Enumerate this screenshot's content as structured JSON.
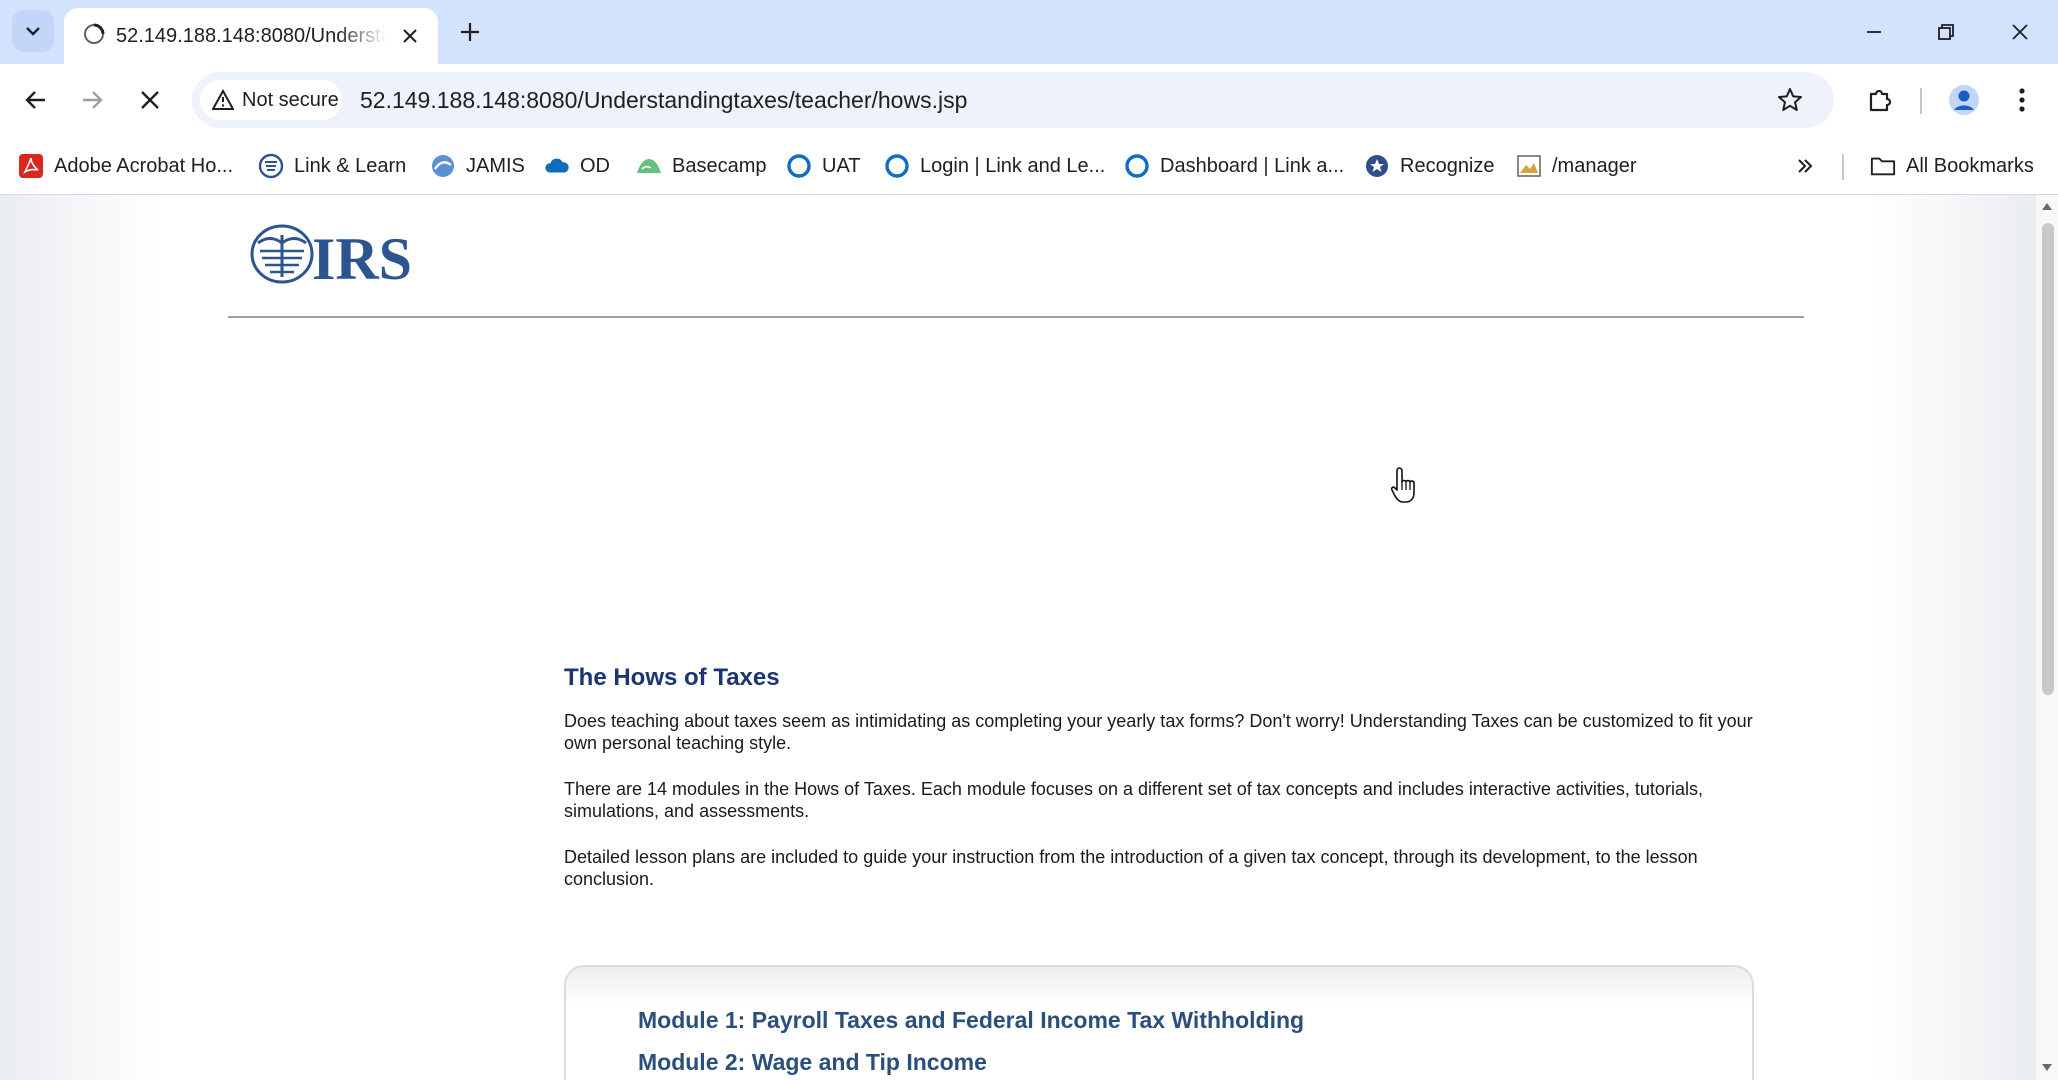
{
  "browser": {
    "tab": {
      "title": "52.149.188.148:8080/Understandingtaxes/teacher/hows.jsp"
    },
    "omnibox": {
      "security_label": "Not secure",
      "url": "52.149.188.148:8080/Understandingtaxes/teacher/hows.jsp"
    },
    "bookmarks": [
      {
        "label": "Adobe Acrobat Ho...",
        "icon": "acrobat-icon"
      },
      {
        "label": "Link & Learn",
        "icon": "irs-eagle-icon"
      },
      {
        "label": "JAMIS",
        "icon": "jamis-icon"
      },
      {
        "label": "OD",
        "icon": "cloud-icon"
      },
      {
        "label": "Basecamp",
        "icon": "basecamp-icon"
      },
      {
        "label": "UAT",
        "icon": "ring-icon"
      },
      {
        "label": "Login | Link and Le...",
        "icon": "ring-icon"
      },
      {
        "label": "Dashboard | Link a...",
        "icon": "ring-icon"
      },
      {
        "label": "Recognize",
        "icon": "recognize-icon"
      },
      {
        "label": "/manager",
        "icon": "image-icon"
      }
    ],
    "all_bookmarks_label": "All Bookmarks"
  },
  "page": {
    "logo_text": "IRS",
    "section_title": "The Hows of Taxes",
    "paragraphs": [
      "Does teaching about taxes seem as intimidating as completing your yearly tax forms? Don't worry! Understanding Taxes can be customized to fit your own personal teaching style.",
      "There are 14 modules in the Hows of Taxes. Each module focuses on a different set of tax concepts and includes interactive activities, tutorials, simulations, and assessments.",
      "Detailed lesson plans are included to guide your instruction from the introduction of a given tax concept, through its development, to the lesson conclusion."
    ],
    "modules": [
      "Module 1: Payroll Taxes and Federal Income Tax Withholding",
      "Module 2: Wage and Tip Income"
    ]
  },
  "colors": {
    "tabstrip": "#d3e3fd",
    "title_blue": "#1a3570",
    "module_link": "#2a4f7d",
    "logo_blue": "#2c5590"
  }
}
